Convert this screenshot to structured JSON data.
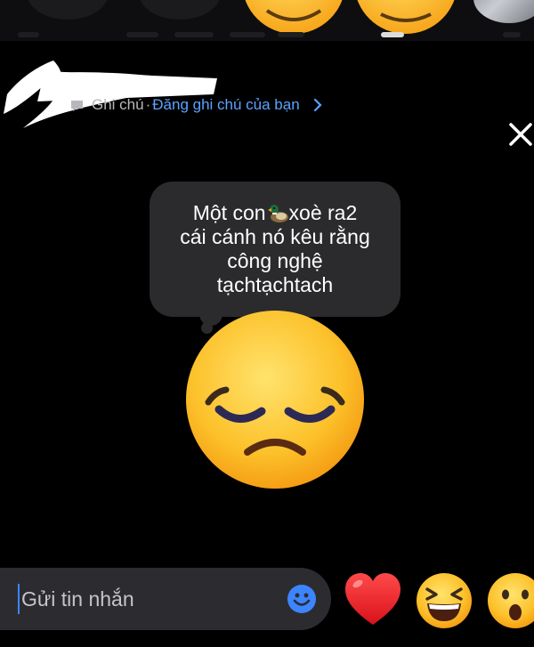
{
  "header": {
    "note_label": "Ghi chú",
    "separator": "·",
    "note_link": "Đăng ghi chú của bạn",
    "chevron": "›",
    "close_icon": "close-x"
  },
  "note": {
    "line1_before_emoji": "Một con",
    "emoji": "duck",
    "line1_after_emoji": "xoè ra2",
    "line2": "cái cánh nó kêu rằng",
    "line3": "công nghệ",
    "line4": "tạchtạchtach"
  },
  "reaction_emoji": "pensive-face",
  "composer": {
    "placeholder": "Gửi tin nhắn",
    "emoji_button": "smiley-icon"
  },
  "quick_reactions": [
    "heart",
    "laughing-face",
    "surprised-face"
  ],
  "colors": {
    "background": "#000000",
    "bubble": "#2b2b2e",
    "link": "#5aa3ff",
    "composer": "#2c2c30",
    "accent": "#3d84ff"
  }
}
